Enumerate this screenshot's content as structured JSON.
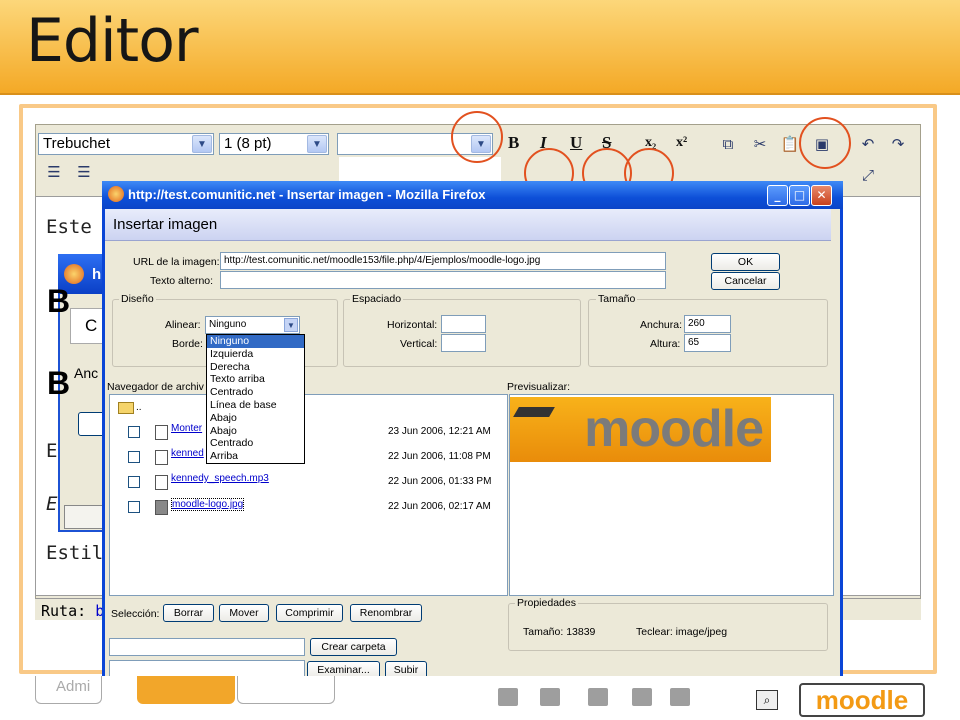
{
  "slide": {
    "title": "Editor"
  },
  "toolbar": {
    "font_family": "Trebuchet",
    "font_size": "1 (8 pt)",
    "bold": "B",
    "italic": "I",
    "underline": "U",
    "strike": "S",
    "subscript": "x₂",
    "superscript": "x²"
  },
  "editor": {
    "lines": [
      "Este e",
      "Estil"
    ],
    "big_letters": [
      "B",
      "B"
    ],
    "partial_labels": [
      "E",
      "E"
    ],
    "path_label": "Ruta:",
    "path_value": "b"
  },
  "background_window": {
    "title_fragment": "h",
    "tab_fragment": "C",
    "text_fragment": "Anc"
  },
  "dialog": {
    "window_title": "http://test.comunitic.net - Insertar imagen - Mozilla Firefox",
    "heading": "Insertar imagen",
    "url_label": "URL de la imagen:",
    "url_value": "http://test.comunitic.net/moodle153/file.php/4/Ejemplos/moodle-logo.jpg",
    "alt_label": "Texto alterno:",
    "alt_value": "",
    "ok": "OK",
    "cancel": "Cancelar",
    "design": {
      "legend": "Diseño",
      "align_label": "Alinear:",
      "align_value": "Ninguno",
      "border_label": "Borde:",
      "align_options": [
        "Ninguno",
        "Izquierda",
        "Derecha",
        "Texto arriba",
        "Centrado",
        "Línea de base",
        "Abajo",
        "Abajo",
        "Centrado",
        "Arriba"
      ]
    },
    "spacing": {
      "legend": "Espaciado",
      "horizontal_label": "Horizontal:",
      "vertical_label": "Vertical:"
    },
    "size": {
      "legend": "Tamaño",
      "width_label": "Anchura:",
      "width_value": "260",
      "height_label": "Altura:",
      "height_value": "65"
    },
    "browser_label": "Navegador de archiv",
    "preview_label": "Previsualizar:",
    "parent_dir": "..",
    "files": [
      {
        "name": "Monter",
        "date": "23 Jun 2006, 12:21 AM"
      },
      {
        "name": "kenned",
        "date": "22 Jun 2006, 11:08 PM"
      },
      {
        "name": "kennedy_speech.mp3",
        "date": "22 Jun 2006, 01:33 PM"
      },
      {
        "name": "moodle-logo.jpg",
        "date": "22 Jun 2006, 02:17 AM"
      }
    ],
    "preview_logo_text": "moodle",
    "selection_label": "Selección:",
    "selection_buttons": [
      "Borrar",
      "Mover",
      "Comprimir",
      "Renombrar"
    ],
    "properties": {
      "legend": "Propiedades",
      "size": "Tamaño: 13839",
      "type": "Teclear: image/jpeg"
    },
    "create_folder": "Crear carpeta",
    "browse": "Examinar...",
    "upload": "Subir"
  },
  "footer": {
    "admin_fragment": "Admi",
    "moodle_logo": "moodle"
  },
  "colors": {
    "banner": "#f4a926",
    "accent_circle": "#e2511f",
    "xp_blue": "#0a45d6",
    "list_select": "#316ac5"
  }
}
